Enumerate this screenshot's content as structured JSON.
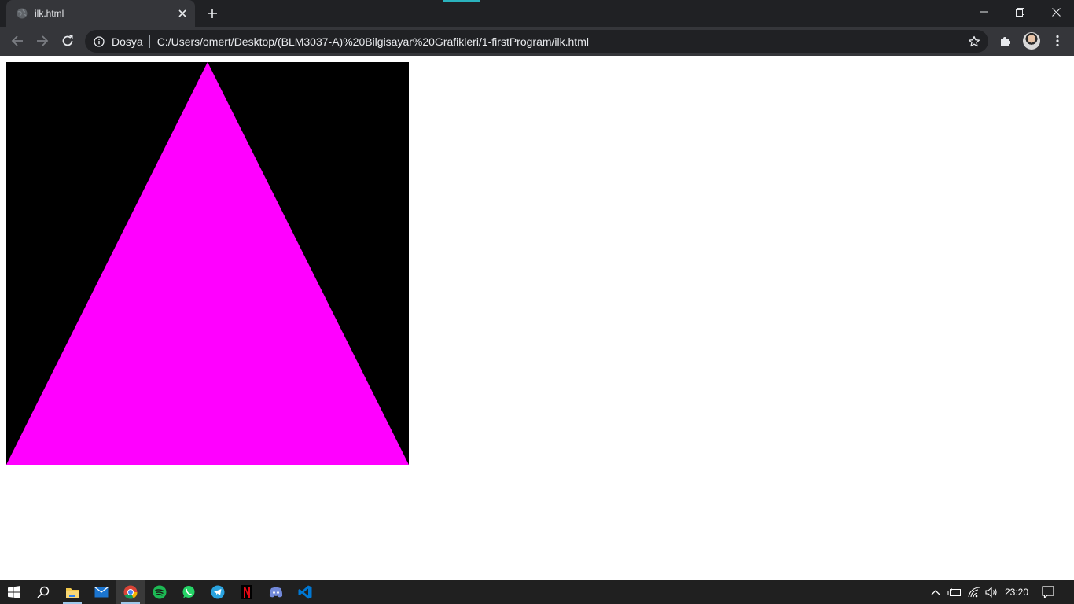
{
  "browser": {
    "tab": {
      "title": "ilk.html"
    },
    "omnibox": {
      "scheme_label": "Dosya",
      "url": "C:/Users/omert/Desktop/(BLM3037-A)%20Bilgisayar%20Grafikleri/1-firstProgram/ilk.html"
    },
    "icons": {
      "favicon": "globe-icon",
      "tab_close": "close-icon",
      "new_tab": "plus-icon",
      "back": "back-arrow-icon",
      "forward": "forward-arrow-icon",
      "reload": "reload-icon",
      "site_info": "info-icon",
      "bookmark": "star-icon",
      "extensions": "puzzle-icon",
      "profile": "avatar-icon",
      "menu": "kebab-menu-icon",
      "minimize": "minimize-icon",
      "restore": "restore-icon",
      "close_window": "close-icon"
    }
  },
  "page": {
    "canvas": {
      "background_color": "#000000",
      "shape": "triangle",
      "fill_color": "#ff00ff"
    }
  },
  "taskbar": {
    "apps": [
      "start-icon",
      "search-icon",
      "file-explorer-icon",
      "mail-icon",
      "chrome-icon",
      "spotify-icon",
      "whatsapp-icon",
      "telegram-icon",
      "netflix-icon",
      "discord-icon",
      "vscode-icon"
    ],
    "tray": {
      "clock": "23:20",
      "icons": [
        "chevron-up-icon",
        "battery-icon",
        "wifi-icon",
        "volume-icon",
        "notification-icon"
      ]
    }
  },
  "colors": {
    "tab_strip": "#202124",
    "toolbar": "#35363a",
    "omnibox": "#202124",
    "taskbar": "#202020",
    "accent": "#2ab2bd"
  }
}
